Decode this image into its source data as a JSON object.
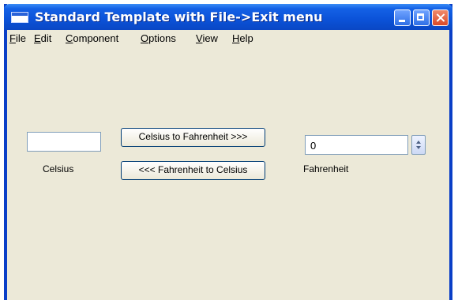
{
  "window": {
    "title": "Standard Template with File->Exit menu"
  },
  "menu": [
    {
      "label": "File",
      "mnemonic": "F",
      "rest": "ile"
    },
    {
      "label": "Edit",
      "mnemonic": "E",
      "rest": "dit"
    },
    {
      "label": "Component",
      "mnemonic": "C",
      "rest": "omponent"
    },
    {
      "label": "Options",
      "mnemonic": "O",
      "rest": "ptions"
    },
    {
      "label": "View",
      "mnemonic": "V",
      "rest": "iew"
    },
    {
      "label": "Help",
      "mnemonic": "H",
      "rest": "elp"
    }
  ],
  "converter": {
    "celsius_value": "",
    "celsius_label": "Celsius",
    "to_fahrenheit_label": "Celsius to Fahrenheit >>>",
    "to_celsius_label": "<<< Fahrenheit to Celsius",
    "fahrenheit_value": "0",
    "fahrenheit_label": "Fahrenheit"
  },
  "colors": {
    "titlebar": "#0b52d8",
    "window_background": "#ece9d8",
    "window_border": "#0a3fc7"
  },
  "icons": [
    "app-icon",
    "minimize-icon",
    "maximize-icon",
    "close-icon",
    "spinner-up-icon",
    "spinner-down-icon"
  ]
}
